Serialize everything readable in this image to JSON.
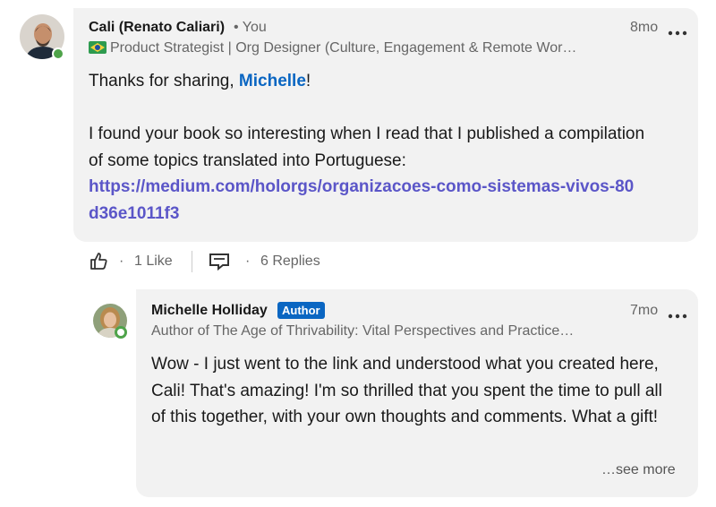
{
  "comment1": {
    "author_name": "Cali (Renato Caliari)",
    "you_label": "• You",
    "time": "8mo",
    "headline": "Product Strategist | Org Designer (Culture, Engagement & Remote Wor…",
    "greeting_prefix": "Thanks for sharing, ",
    "mention": "Michelle",
    "greeting_suffix": "!",
    "paragraph": "I found your book so interesting when I read that I published a compilation of some topics translated into Portuguese:",
    "link": "https://medium.com/holorgs/organizacoes-como-sistemas-vivos-80d36e1011f3",
    "like_count": "1 Like",
    "reply_count": "6 Replies",
    "dot": "·"
  },
  "comment2": {
    "author_name": "Michelle Holliday",
    "badge": "Author",
    "time": "7mo",
    "headline": "Author of The Age of Thrivability: Vital Perspectives and Practice…",
    "text": "Wow - I just went to the link and understood what you created here, Cali! That's amazing! I'm so thrilled that you spent the time to pull all of this together, with your own thoughts and comments. What a gift!",
    "see_more": "…see more"
  },
  "icons": {
    "like": "thumbs-up-icon",
    "reply": "comment-icon",
    "overflow": "ellipsis-icon",
    "flag": "brazil-flag-icon"
  },
  "colors": {
    "mention": "#0a66c2",
    "link": "#5b56c8",
    "bubble": "#f2f2f2",
    "presence": "#4fa34a",
    "badge": "#0a66c2"
  }
}
